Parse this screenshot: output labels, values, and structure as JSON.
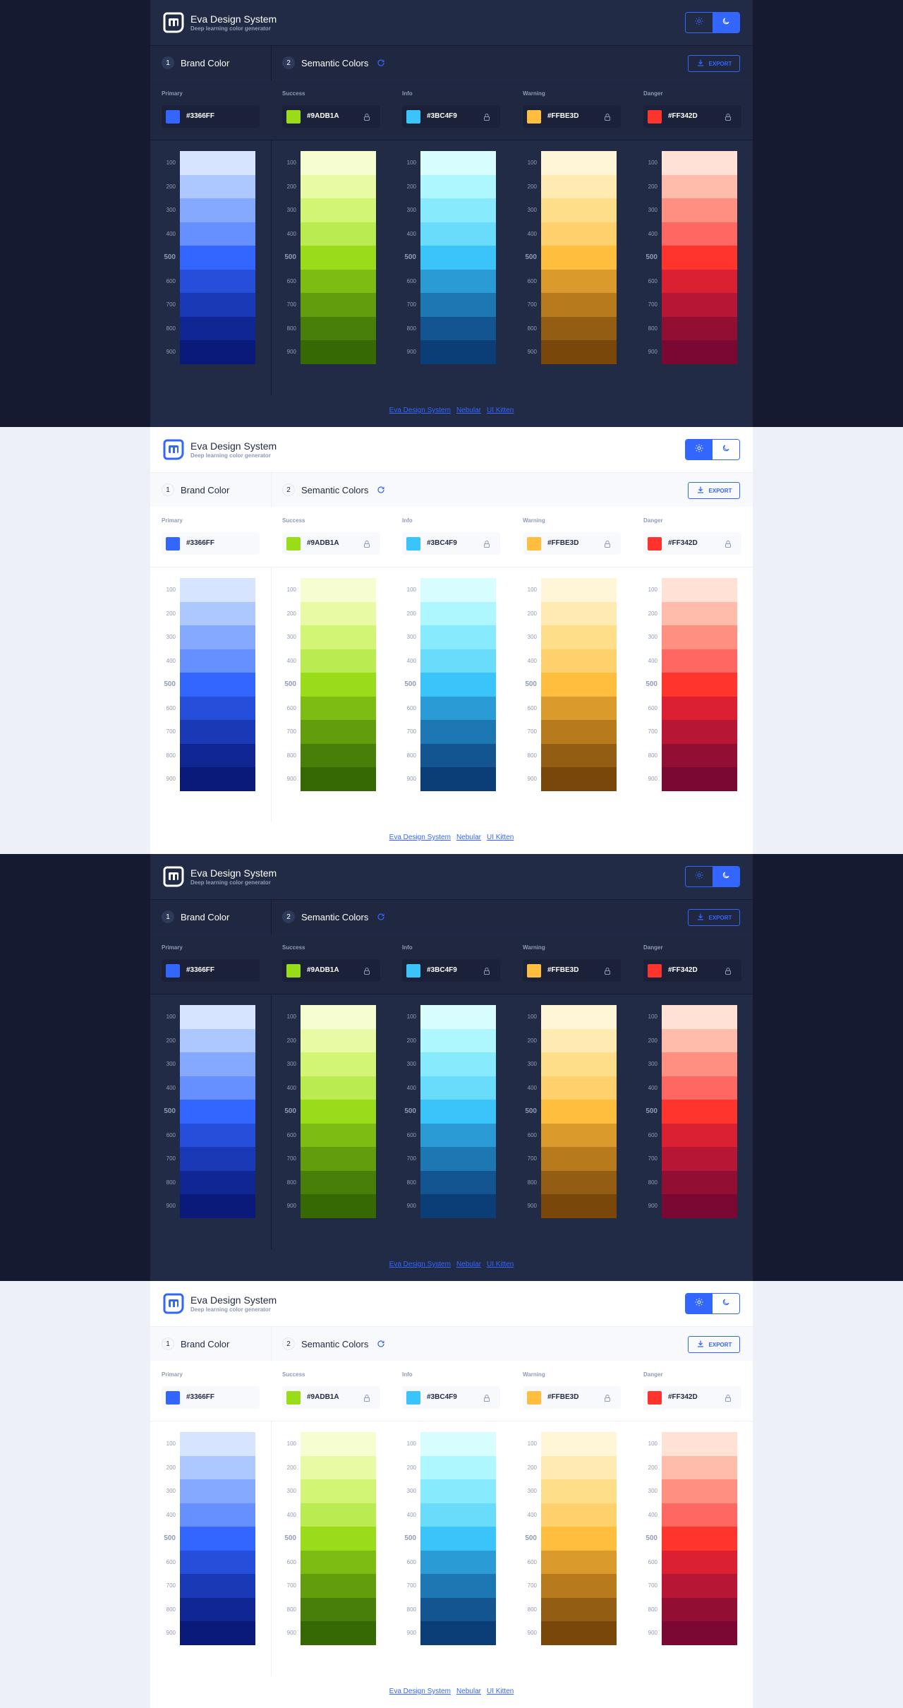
{
  "app": {
    "title": "Eva Design System",
    "subtitle": "Deep learning color generator"
  },
  "theme_toggle": {
    "light_icon": "sun-icon",
    "dark_icon": "moon-icon"
  },
  "steps": [
    {
      "number": "1",
      "label": "Brand Color"
    },
    {
      "number": "2",
      "label": "Semantic Colors"
    }
  ],
  "export_label": "EXPORT",
  "colors": [
    {
      "label": "Primary",
      "hex": "#3366FF",
      "locked": false,
      "shades": [
        "#D6E4FF",
        "#ADC8FF",
        "#84A9FF",
        "#6690FF",
        "#3366FF",
        "#254EDB",
        "#1939B7",
        "#102693",
        "#091A7A"
      ]
    },
    {
      "label": "Success",
      "hex": "#9ADB1A",
      "locked": true,
      "shades": [
        "#F5FDD1",
        "#E8FBA4",
        "#D2F575",
        "#BAEB51",
        "#9ADB1A",
        "#7CBC13",
        "#619D0D",
        "#487F08",
        "#366904"
      ]
    },
    {
      "label": "Info",
      "hex": "#3BC4F9",
      "locked": true,
      "shades": [
        "#D7FDFE",
        "#AFF7FE",
        "#87EBFD",
        "#69DBFB",
        "#3BC4F9",
        "#2B9BD6",
        "#1D77B3",
        "#125590",
        "#0B3D77"
      ]
    },
    {
      "label": "Warning",
      "hex": "#FFBE3D",
      "locked": true,
      "shades": [
        "#FFF6D8",
        "#FFEBB1",
        "#FFDE8A",
        "#FFD16C",
        "#FFBE3D",
        "#DB9B2C",
        "#B77B1E",
        "#935D13",
        "#7A470B"
      ]
    },
    {
      "label": "Danger",
      "hex": "#FF342D",
      "locked": true,
      "shades": [
        "#FFE1D5",
        "#FFBCAB",
        "#FF9081",
        "#FF6862",
        "#FF342D",
        "#DB2131",
        "#B71634",
        "#930E33",
        "#7A0832"
      ]
    }
  ],
  "shade_levels": [
    "100",
    "200",
    "300",
    "400",
    "500",
    "600",
    "700",
    "800",
    "900"
  ],
  "footer_links": [
    "Eva Design System",
    "Nebular",
    "UI Kitten"
  ],
  "theme_accent": "#3366FF",
  "panels": [
    "dark",
    "light",
    "dark",
    "light"
  ]
}
